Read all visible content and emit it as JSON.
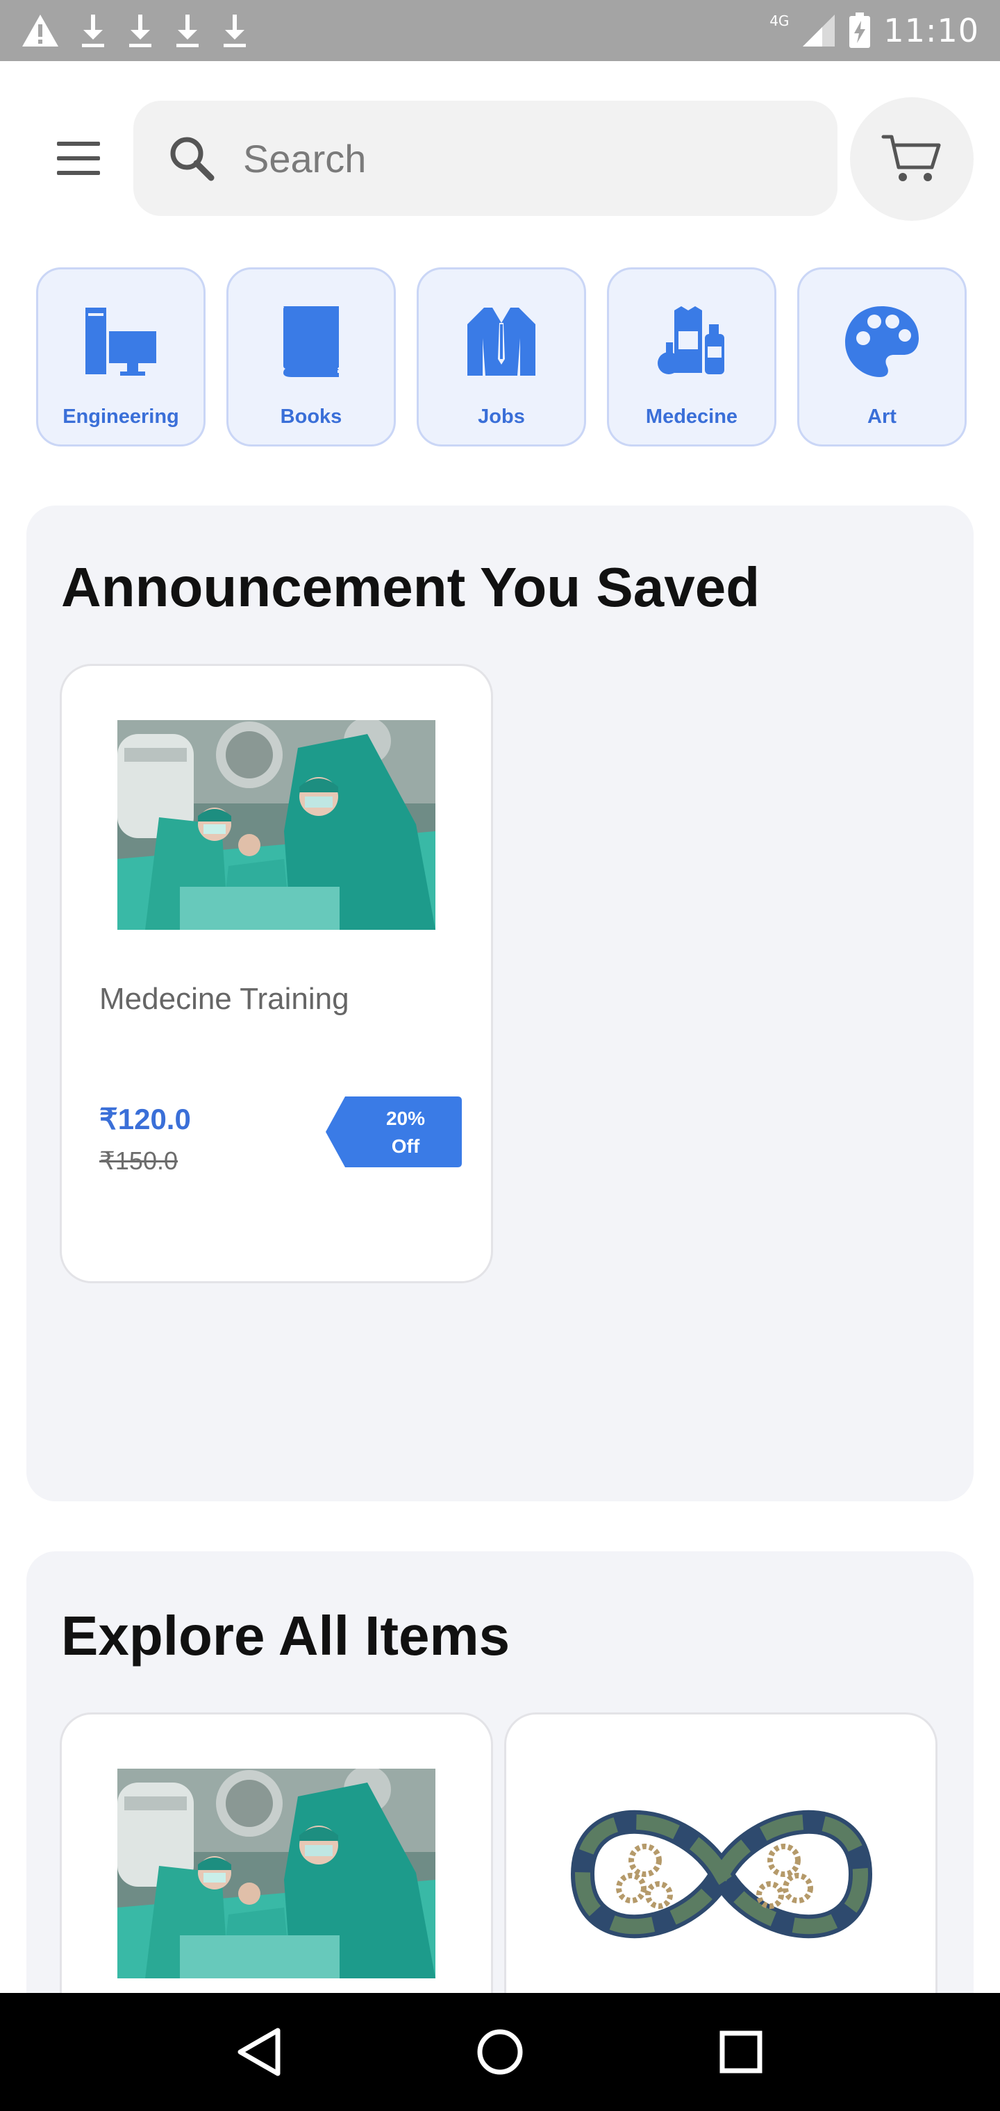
{
  "status_bar": {
    "time": "11:10",
    "network_label": "4G",
    "left_icons": [
      "warning-icon",
      "download-icon",
      "download-icon",
      "download-icon",
      "download-icon"
    ],
    "right_icons": [
      "signal-icon",
      "battery-charging-icon"
    ]
  },
  "search": {
    "placeholder": "Search"
  },
  "categories": [
    {
      "label": "Engineering",
      "icon": "engineering-icon"
    },
    {
      "label": "Books",
      "icon": "book-icon"
    },
    {
      "label": "Jobs",
      "icon": "suit-icon"
    },
    {
      "label": "Medecine",
      "icon": "medicine-icon"
    },
    {
      "label": "Art",
      "icon": "palette-icon"
    }
  ],
  "saved_section": {
    "title": "Announcement You Saved",
    "items": [
      {
        "title": "Medecine Training",
        "price": "₹120.0",
        "old_price": "₹150.0",
        "discount_line1": "20%",
        "discount_line2": "Off"
      }
    ]
  },
  "explore_section": {
    "title": "Explore All Items"
  },
  "colors": {
    "accent": "#3a6fd8",
    "category_bg": "#edf2fd",
    "section_bg": "#f3f4f8"
  }
}
